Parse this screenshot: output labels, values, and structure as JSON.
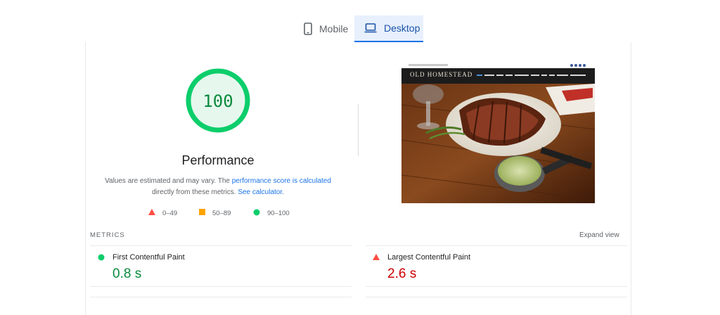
{
  "tabs": {
    "mobile_label": "Mobile",
    "desktop_label": "Desktop"
  },
  "gauge": {
    "score": "100",
    "score_fraction": 1.0,
    "color": "#0cce6b",
    "fill": "#e6f7ee"
  },
  "performance": {
    "title": "Performance",
    "desc_prefix": "Values are estimated and may vary. The ",
    "desc_link1": "performance score is calculated",
    "desc_middle": "directly from these metrics. ",
    "desc_link2": "See calculator."
  },
  "legend": {
    "poor": "0–49",
    "average": "50–89",
    "good": "90–100",
    "poor_color": "#ff4e42",
    "average_color": "#ffa400",
    "good_color": "#0cce6b"
  },
  "screenshot": {
    "brand": "OLD HOMESTEAD"
  },
  "metrics": {
    "header": "METRICS",
    "expand_label": "Expand view",
    "fcp": {
      "name": "First Contentful Paint",
      "value": "0.8 s",
      "status": "good"
    },
    "lcp": {
      "name": "Largest Contentful Paint",
      "value": "2.6 s",
      "status": "poor"
    }
  }
}
